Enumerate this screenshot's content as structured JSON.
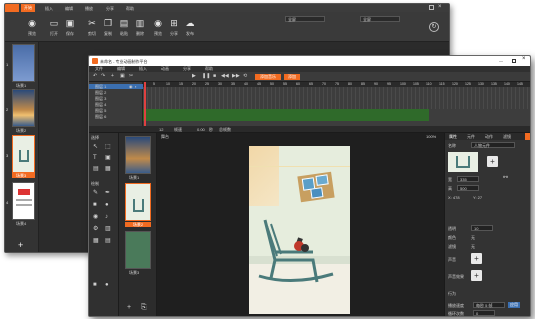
{
  "back_window": {
    "tab_label": "开始",
    "menus": [
      "插入",
      "编辑",
      "播放",
      "分享",
      "帮助"
    ],
    "toolbar": [
      {
        "label": "预览",
        "icon": "eye-icon"
      },
      {
        "label": "打开",
        "icon": "folder-icon"
      },
      {
        "label": "保存",
        "icon": "save-icon"
      },
      {
        "label": "剪切",
        "icon": "scissors-icon"
      },
      {
        "label": "复制",
        "icon": "copy-icon"
      },
      {
        "label": "粘贴",
        "icon": "paste-icon"
      },
      {
        "label": "删除",
        "icon": "trash-icon"
      },
      {
        "label": "预览",
        "icon": "eye-icon"
      },
      {
        "label": "分享",
        "icon": "share-icon"
      },
      {
        "label": "发布",
        "icon": "cloud-upload-icon"
      }
    ],
    "dropdown_values": [
      "全屏",
      "全屏"
    ],
    "thumb_labels": [
      "场景1",
      "场景2",
      "场景3",
      "场景4"
    ],
    "thumb_numbers": [
      "1",
      "2",
      "3",
      "4"
    ]
  },
  "front_window": {
    "title": "未命名 - 专业动画制作平台",
    "menus": [
      "文件",
      "编辑",
      "插入",
      "动画",
      "分享",
      "帮助"
    ],
    "toolbar_buttons": [
      "添加音乐",
      "添加"
    ],
    "layers": [
      "图层 1",
      "图层 2",
      "图层 3",
      "图层 4",
      "图层 5",
      "图层 6"
    ],
    "frame_numbers": [
      "5",
      "10",
      "15",
      "20",
      "25",
      "30",
      "35",
      "40",
      "45",
      "50",
      "55",
      "60",
      "65",
      "70",
      "75",
      "80",
      "85",
      "90",
      "95",
      "100",
      "105",
      "110",
      "115",
      "120",
      "125",
      "130",
      "135",
      "140",
      "145"
    ],
    "status": [
      "12",
      "帧速",
      "0.00",
      "秒",
      "总帧数"
    ],
    "tools_header": "选择",
    "tools_header2": "绘制",
    "stage_label": "舞台",
    "scene_labels": [
      "场景1",
      "场景2",
      "场景3"
    ],
    "zoom_value": "100%",
    "props": {
      "tabs": [
        "属性",
        "元件",
        "动作",
        "滤镜"
      ],
      "name_label": "名称",
      "name_value": "人物元件",
      "dim_w_label": "宽",
      "dim_w": "335",
      "dim_h_label": "高",
      "dim_h": "500",
      "coord_x": "X: 478",
      "coord_y": "Y: 27",
      "rows": [
        {
          "label": "透明",
          "value": "10"
        },
        {
          "label": "颜色",
          "value": "无"
        },
        {
          "label": "滤镜",
          "value": "无"
        },
        {
          "label": "声音",
          "value": ""
        },
        {
          "label": "声音效果",
          "value": ""
        },
        {
          "label": "行为",
          "value": ""
        }
      ],
      "footer_label": "播放速度",
      "footer_value": "每秒 5 帧",
      "footer_btn": "应用",
      "footer_label2": "循环次数",
      "footer_value2": "0"
    }
  },
  "colors": {
    "accent": "#f26b21",
    "wall": "#e6eddd",
    "chair": "#4a7a7a",
    "sun": "#f4d29a"
  }
}
